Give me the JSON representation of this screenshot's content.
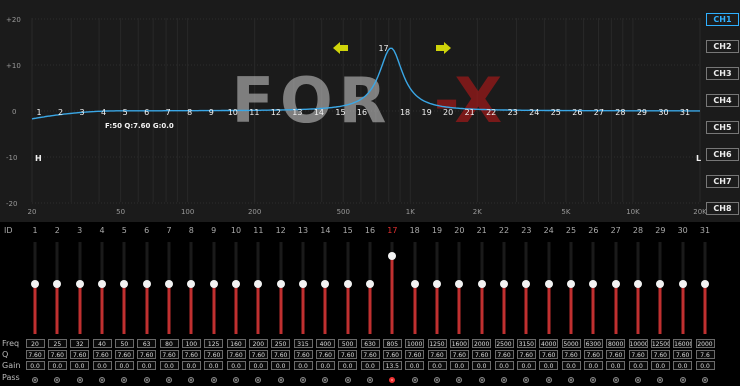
{
  "graph": {
    "db_labels": [
      "+20",
      "+10",
      "0",
      "-10",
      "-20"
    ],
    "freq_labels": [
      "20",
      "50",
      "100",
      "200",
      "500",
      "1K",
      "2K",
      "5K",
      "10K",
      "20K"
    ],
    "point_labels": [
      "1",
      "2",
      "3",
      "4",
      "5",
      "6",
      "7",
      "8",
      "9",
      "10",
      "11",
      "12",
      "13",
      "14",
      "15",
      "16",
      "17",
      "18",
      "19",
      "20",
      "21",
      "22",
      "23",
      "24",
      "25",
      "26",
      "27",
      "28",
      "29",
      "30",
      "31"
    ],
    "info_text": "F:50 Q:7.60 G:0.0",
    "left_marker": "H",
    "right_marker": "L",
    "watermark": "FOR-X",
    "curve_color": "#3aa7e6",
    "arrow_color": "#cfd40a"
  },
  "channels": [
    "CH1",
    "CH2",
    "CH3",
    "CH4",
    "CH5",
    "CH6",
    "CH7",
    "CH8"
  ],
  "active_channel_index": 0,
  "bands": {
    "id_label": "ID",
    "ids": [
      "1",
      "2",
      "3",
      "4",
      "5",
      "6",
      "7",
      "8",
      "9",
      "10",
      "11",
      "12",
      "13",
      "14",
      "15",
      "16",
      "17",
      "18",
      "19",
      "20",
      "21",
      "22",
      "23",
      "24",
      "25",
      "26",
      "27",
      "28",
      "29",
      "30",
      "31"
    ],
    "active_index": 16,
    "freq": [
      "20",
      "25",
      "32",
      "40",
      "50",
      "63",
      "80",
      "100",
      "125",
      "160",
      "200",
      "250",
      "315",
      "400",
      "500",
      "630",
      "805",
      "1000",
      "1250",
      "1600",
      "2000",
      "2500",
      "3150",
      "4000",
      "5000",
      "6300",
      "8000",
      "10000",
      "12500",
      "16000",
      "2000"
    ],
    "q": [
      "7.60",
      "7.60",
      "7.60",
      "7.60",
      "7.60",
      "7.60",
      "7.60",
      "7.60",
      "7.60",
      "7.60",
      "7.60",
      "7.60",
      "7.60",
      "7.60",
      "7.60",
      "7.60",
      "7.60",
      "7.60",
      "7.60",
      "7.60",
      "7.60",
      "7.60",
      "7.60",
      "7.60",
      "7.60",
      "7.60",
      "7.60",
      "7.60",
      "7.60",
      "7.60",
      "7.6"
    ],
    "gain": [
      "0.0",
      "0.0",
      "0.0",
      "0.0",
      "0.0",
      "0.0",
      "0.0",
      "0.0",
      "0.0",
      "0.0",
      "0.0",
      "0.0",
      "0.0",
      "0.0",
      "0.0",
      "0.0",
      "13.5",
      "0.0",
      "0.0",
      "0.0",
      "0.0",
      "0.0",
      "0.0",
      "0.0",
      "0.0",
      "0.0",
      "0.0",
      "0.0",
      "0.0",
      "0.0",
      "0.0"
    ],
    "gain_values": [
      0,
      0,
      0,
      0,
      0,
      0,
      0,
      0,
      0,
      0,
      0,
      0,
      0,
      0,
      0,
      0,
      13.5,
      0,
      0,
      0,
      0,
      0,
      0,
      0,
      0,
      0,
      0,
      0,
      0,
      0,
      0
    ],
    "gain_range": [
      -20,
      20
    ]
  },
  "rows": {
    "freq_label": "Freq",
    "q_label": "Q",
    "gain_label": "Gain",
    "pass_label": "Pass"
  }
}
